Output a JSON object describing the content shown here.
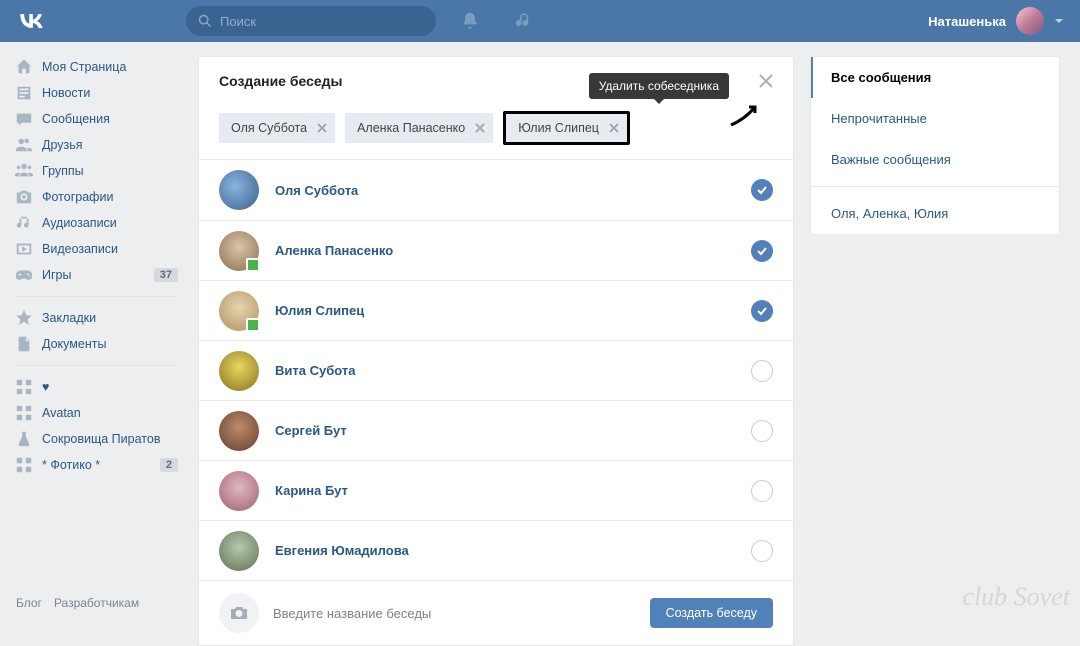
{
  "header": {
    "search_placeholder": "Поиск",
    "username": "Наташенька"
  },
  "sidebar": {
    "items": [
      {
        "label": "Моя Страница"
      },
      {
        "label": "Новости"
      },
      {
        "label": "Сообщения"
      },
      {
        "label": "Друзья"
      },
      {
        "label": "Группы"
      },
      {
        "label": "Фотографии"
      },
      {
        "label": "Аудиозаписи"
      },
      {
        "label": "Видеозаписи"
      },
      {
        "label": "Игры",
        "badge": "37"
      }
    ],
    "items2": [
      {
        "label": "Закладки"
      },
      {
        "label": "Документы"
      }
    ],
    "items3": [
      {
        "label": "♥"
      },
      {
        "label": "Avatan"
      },
      {
        "label": "Сокровища Пиратов"
      },
      {
        "label": "* Фотико *",
        "badge": "2"
      }
    ],
    "footer": {
      "blog": "Блог",
      "dev": "Разработчикам"
    }
  },
  "dialog": {
    "title": "Создание беседы",
    "tooltip": "Удалить собеседника",
    "chips": [
      {
        "name": "Оля Суббота"
      },
      {
        "name": "Аленка Панасенко"
      },
      {
        "name": "Юлия Слипец"
      }
    ],
    "friends": [
      {
        "name": "Оля Суббота",
        "selected": true,
        "online": false
      },
      {
        "name": "Аленка Панасенко",
        "selected": true,
        "online": true
      },
      {
        "name": "Юлия Слипец",
        "selected": true,
        "online": true
      },
      {
        "name": "Вита Субота",
        "selected": false,
        "online": false
      },
      {
        "name": "Сергей Бут",
        "selected": false,
        "online": false
      },
      {
        "name": "Карина Бут",
        "selected": false,
        "online": false
      },
      {
        "name": "Евгения Юмадилова",
        "selected": false,
        "online": false
      }
    ],
    "input_placeholder": "Введите название беседы",
    "create_button": "Создать беседу"
  },
  "filters": {
    "items": [
      {
        "label": "Все сообщения",
        "active": true
      },
      {
        "label": "Непрочитанные"
      },
      {
        "label": "Важные сообщения"
      }
    ],
    "recent": "Оля, Аленка, Юлия"
  },
  "watermark": "club Sovet"
}
